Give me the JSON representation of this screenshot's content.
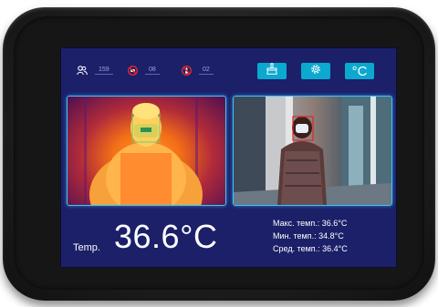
{
  "counters": {
    "people_count": "159",
    "no_mask_count": "08",
    "fever_count": "02"
  },
  "toolbar": {
    "temp_unit": "°C"
  },
  "readings": {
    "temp_label": "Temp.",
    "current_temp": "36.6°C",
    "max_line": "Макс. темп.: 36.6°C",
    "min_line": "Мин. темп.: 34.8°C",
    "avg_line": "Сред. темп.: 36.4°C"
  },
  "colors": {
    "screen_bg": "#1c2069",
    "accent": "#0ba8cf",
    "panel_border": "#38c6ff",
    "alert_red": "#e2262c"
  },
  "icons": {
    "people": "people-icon",
    "no_mask": "no-mask-icon",
    "fever": "fever-icon",
    "clean": "broom-icon",
    "settings": "gear-icon"
  }
}
